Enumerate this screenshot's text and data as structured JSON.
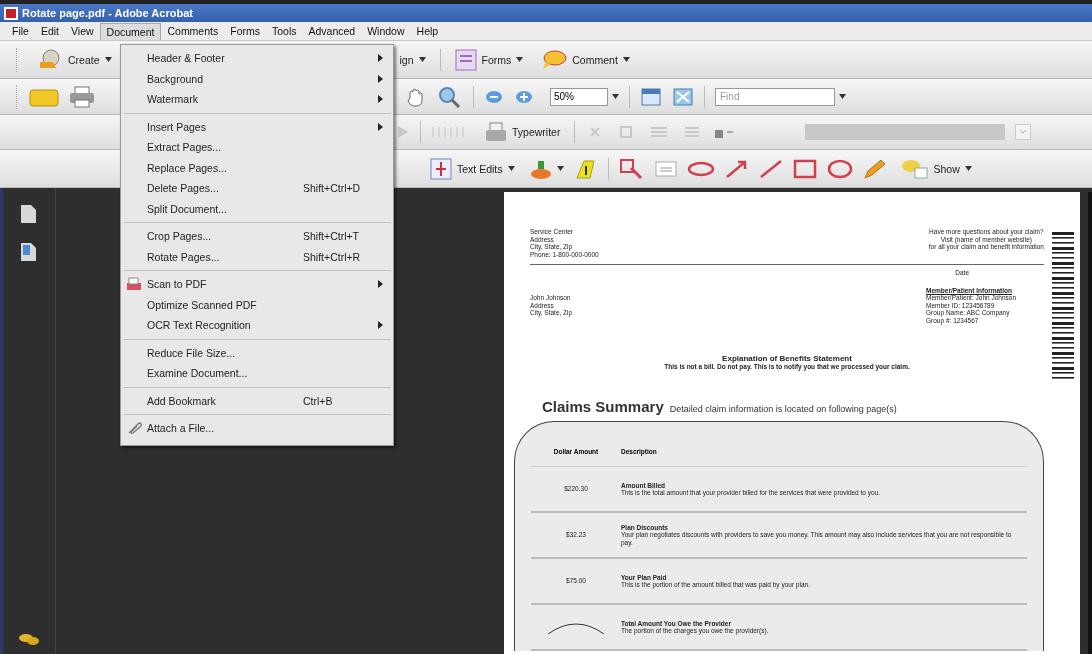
{
  "window": {
    "title": "Rotate page.pdf - Adobe Acrobat"
  },
  "menu_bar": [
    {
      "label": "File",
      "selected": false
    },
    {
      "label": "Edit",
      "selected": false
    },
    {
      "label": "View",
      "selected": false
    },
    {
      "label": "Document",
      "selected": true
    },
    {
      "label": "Comments",
      "selected": false
    },
    {
      "label": "Forms",
      "selected": false
    },
    {
      "label": "Tools",
      "selected": false
    },
    {
      "label": "Advanced",
      "selected": false
    },
    {
      "label": "Window",
      "selected": false
    },
    {
      "label": "Help",
      "selected": false
    }
  ],
  "document_menu": [
    [
      {
        "label": "Header & Footer",
        "submenu": true
      },
      {
        "label": "Background",
        "submenu": true
      },
      {
        "label": "Watermark",
        "submenu": true
      }
    ],
    [
      {
        "label": "Insert Pages",
        "submenu": true
      },
      {
        "label": "Extract Pages...",
        "submenu": false
      },
      {
        "label": "Replace Pages...",
        "submenu": false
      },
      {
        "label": "Delete Pages...",
        "shortcut": "Shift+Ctrl+D",
        "submenu": false
      },
      {
        "label": "Split Document...",
        "submenu": false
      }
    ],
    [
      {
        "label": "Crop Pages...",
        "shortcut": "Shift+Ctrl+T",
        "submenu": false
      },
      {
        "label": "Rotate Pages...",
        "shortcut": "Shift+Ctrl+R",
        "submenu": false
      }
    ],
    [
      {
        "label": "Scan to PDF",
        "kind": "scan",
        "submenu": true
      },
      {
        "label": "Optimize Scanned PDF",
        "submenu": false
      },
      {
        "label": "OCR Text Recognition",
        "submenu": true
      }
    ],
    [
      {
        "label": "Reduce File Size...",
        "submenu": false
      },
      {
        "label": "Examine Document...",
        "submenu": false
      }
    ],
    [
      {
        "label": "Add Bookmark",
        "shortcut": "Ctrl+B",
        "submenu": false
      }
    ],
    [
      {
        "label": "Attach a File...",
        "kind": "attach",
        "submenu": false
      }
    ]
  ],
  "task_toolbar": [
    {
      "label": "Create"
    },
    {
      "label": "ign"
    },
    {
      "label": "Forms"
    },
    {
      "label": "Comment"
    }
  ],
  "file_toolbar": {
    "zoom": "50%",
    "find_placeholder": "Find"
  },
  "typewriter_toolbar": {
    "label": "Typewriter"
  },
  "comment_toolbar": {
    "text_edits": "Text Edits",
    "show": "Show"
  },
  "document": {
    "sender": [
      "Service Center",
      "Address",
      "City, State, Zip",
      "Phone: 1-800-000-0000"
    ],
    "help": [
      "Have more questions about your claim?",
      "Visit (name of member website)",
      "for all your claim and benefit information"
    ],
    "date": "Date",
    "recipient": [
      "John Johnson",
      "Address",
      "City, State, Zip"
    ],
    "member_title": "Member/Patient Information",
    "member_lines": [
      "Member/Patient: John Johnson",
      "Member ID: 123456789",
      "Group Name: ABC Company",
      "Group #: 1234567"
    ],
    "statement_title": "Explanation of Benefits Statement",
    "statement_note": "This is not a bill.  Do not pay. This is to notify you that we processed your claim.",
    "summary_title": "Claims Summary",
    "summary_note": "Detailed claim information is located on following page(s)",
    "columns": [
      "Dollar Amount",
      "Description"
    ],
    "rows": [
      {
        "amount": "$220.30",
        "title": "Amount Billed",
        "text": "This is the total amount that your provider billed for the services that were provided to you."
      },
      {
        "amount": "$32.23",
        "title": "Plan Discounts",
        "text": "Your plan negotiates discounts with providers to save you money. This amount may also include services that you are not responsible to pay."
      },
      {
        "amount": "$75.00",
        "title": "Your Plan Paid",
        "text": "This is the portion of the amount billed that was paid by your plan."
      },
      {
        "kind": "total",
        "title": "Total Amount You Owe the Provider",
        "text": "The portion of the charges you owe the provider(s)."
      }
    ]
  }
}
